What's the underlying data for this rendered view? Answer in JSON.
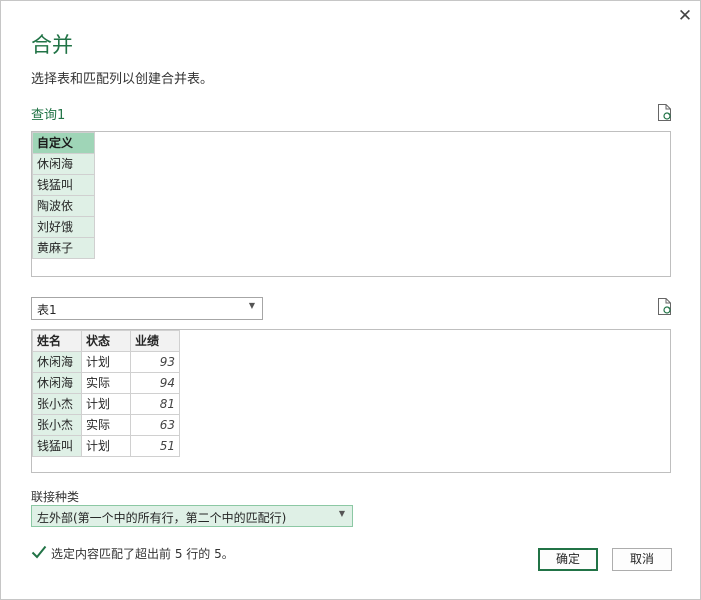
{
  "dialog": {
    "close_glyph": "✕",
    "title": "合并",
    "description": "选择表和匹配列以创建合并表。"
  },
  "query1": {
    "label": "查询1",
    "table": {
      "header": "自定义",
      "rows": [
        "休闲海",
        "钱猛叫",
        "陶波依",
        "刘好饿",
        "黄麻子"
      ]
    }
  },
  "table1": {
    "selected": "表1",
    "columns": [
      "姓名",
      "状态",
      "业绩"
    ],
    "rows": [
      [
        "休闲海",
        "计划",
        "93"
      ],
      [
        "休闲海",
        "实际",
        "94"
      ],
      [
        "张小杰",
        "计划",
        "81"
      ],
      [
        "张小杰",
        "实际",
        "63"
      ],
      [
        "钱猛叫",
        "计划",
        "51"
      ]
    ]
  },
  "join": {
    "label": "联接种类",
    "selected": "左外部(第一个中的所有行，第二个中的匹配行)"
  },
  "status": {
    "message": "选定内容匹配了超出前 5 行的 5。"
  },
  "buttons": {
    "ok": "确定",
    "cancel": "取消"
  },
  "colors": {
    "accent": "#217346",
    "selected_header": "#9fd5b7",
    "selected_cell": "#dff0e6"
  },
  "icons": {
    "close": "close-icon",
    "refresh": "refresh-icon",
    "check": "checkmark-icon",
    "dropdown": "dropdown-arrow-icon"
  }
}
